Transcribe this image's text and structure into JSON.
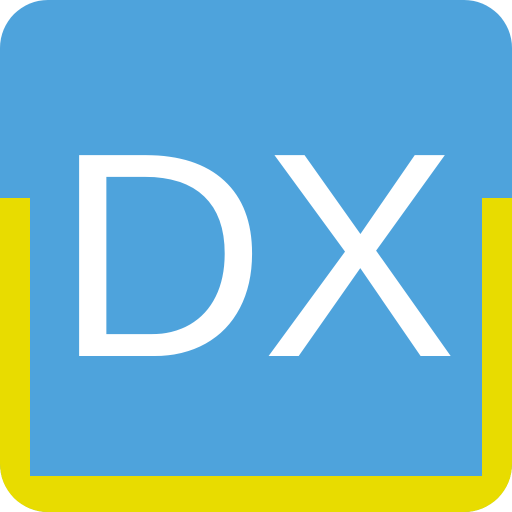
{
  "icon": {
    "monogram": "DX",
    "colors": {
      "background": "#4ea3dc",
      "frame": "#e8dc00",
      "text": "#ffffff"
    }
  }
}
